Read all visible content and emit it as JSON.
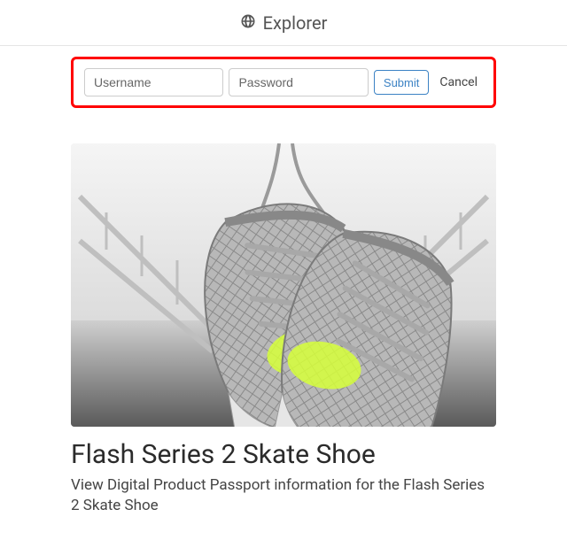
{
  "header": {
    "title": "Explorer",
    "icon": "globe-icon"
  },
  "login": {
    "username_placeholder": "Username",
    "password_placeholder": "Password",
    "submit_label": "Submit",
    "cancel_label": "Cancel"
  },
  "product": {
    "title": "Flash Series 2 Skate Shoe",
    "description": "View Digital Product Passport information for the Flash Series 2 Skate Shoe",
    "image_alt": "Pair of grey mesh sneakers with neon-yellow accents hanging by laces over a bridge railing"
  }
}
